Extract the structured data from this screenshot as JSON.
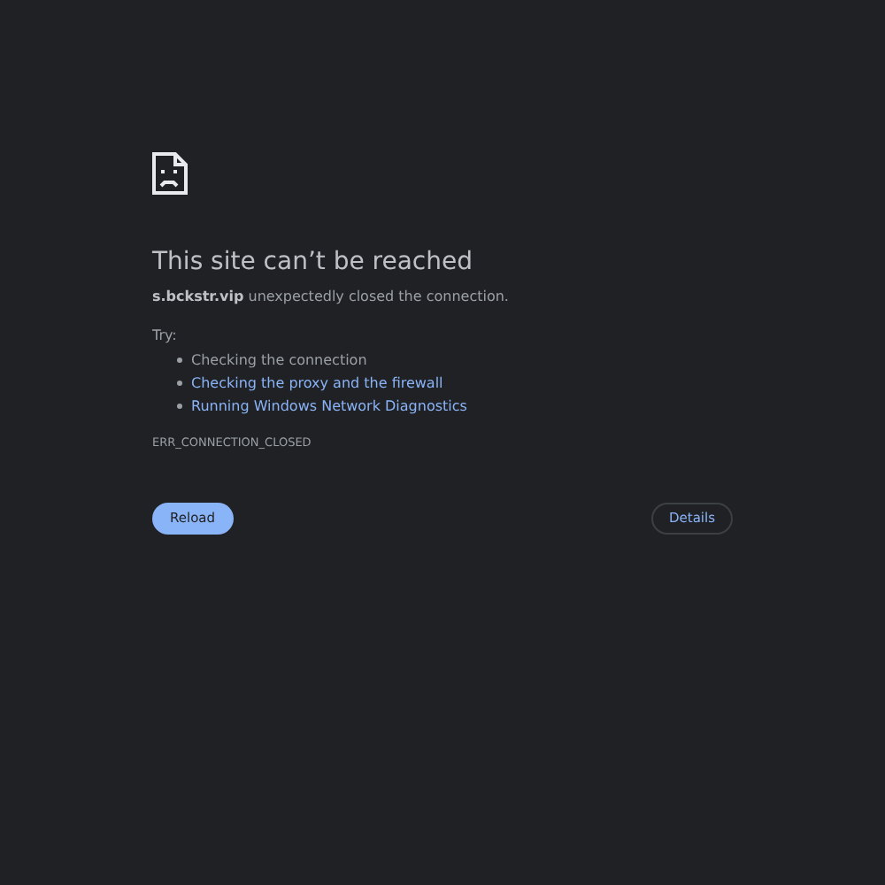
{
  "title": "This site can’t be reached",
  "message": "**s.bckstr.vip** unexpectedly closed the connection.",
  "try_label": "Try:",
  "suggestions": [
    {
      "kind": "text",
      "label": "Checking the connection"
    },
    {
      "kind": "link",
      "label": "Checking the proxy and the firewall"
    },
    {
      "kind": "link",
      "label": "Running Windows Network Diagnostics"
    }
  ],
  "error_code": "ERR_CONNECTION_CLOSED",
  "buttons": [
    {
      "kind": "primary",
      "label": "Reload"
    },
    {
      "kind": "secondary",
      "label": "Details"
    }
  ]
}
